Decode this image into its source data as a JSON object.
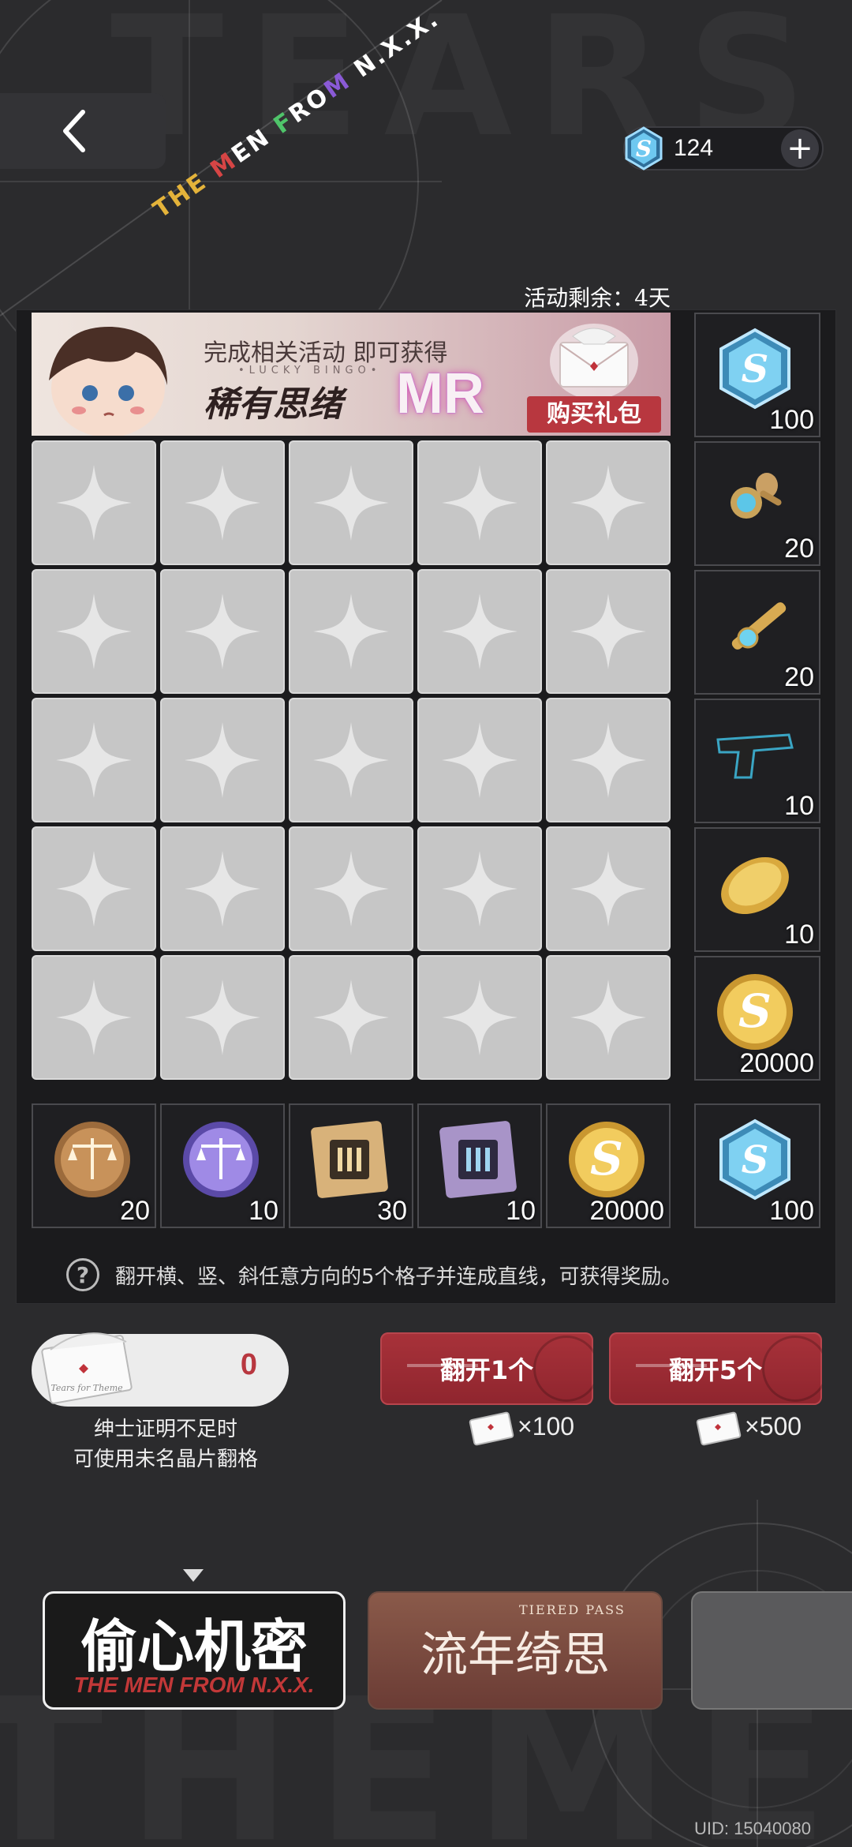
{
  "header": {
    "brand": [
      "THE ",
      "M",
      "EN ",
      "F",
      "RO",
      "M",
      " N.X.X."
    ],
    "currency_value": "124",
    "remaining_label": "活动剩余：4天"
  },
  "banner": {
    "line1": "完成相关活动 即可获得",
    "tagline": "•LUCKY BINGO•",
    "line2": "稀有思绪",
    "rarity": "MR",
    "buy_label": "购买礼包"
  },
  "board": {
    "rows": 5,
    "cols": 5
  },
  "row_rewards": [
    {
      "icon": "hexagon-s-crystal-icon",
      "qty": "100"
    },
    {
      "icon": "blue-gem-cufflink-icon",
      "qty": "20"
    },
    {
      "icon": "gold-tie-clip-icon",
      "qty": "20"
    },
    {
      "icon": "pistol-icon",
      "qty": "10"
    },
    {
      "icon": "gold-coin-tilted-icon",
      "qty": "10"
    },
    {
      "icon": "gold-s-coin-icon",
      "qty": "20000"
    }
  ],
  "col_rewards": [
    {
      "icon": "bronze-scales-badge-icon",
      "qty": "20"
    },
    {
      "icon": "purple-scales-badge-icon",
      "qty": "10"
    },
    {
      "icon": "gold-chip-card-icon",
      "qty": "30"
    },
    {
      "icon": "purple-chip-card-icon",
      "qty": "10"
    },
    {
      "icon": "gold-s-coin-icon",
      "qty": "20000"
    }
  ],
  "corner_reward": {
    "icon": "hexagon-s-crystal-icon",
    "qty": "100"
  },
  "rule": "翻开横、竖、斜任意方向的5个格子并连成直线，可获得奖励。",
  "ticket": {
    "count": "0",
    "note_line1": "绅士证明不足时",
    "note_line2": "可使用未名晶片翻格"
  },
  "actions": {
    "flip_one": "翻开1个",
    "flip_one_cost": "×100",
    "flip_five": "翻开5个",
    "flip_five_cost": "×500"
  },
  "tabs": {
    "tab1_title": "偷心机密",
    "tab1_sub": "THE MEN FROM N.X.X.",
    "tab2_sub": "TIERED PASS",
    "tab2_title": "流年绮思"
  },
  "uid": "UID: 15040080",
  "colors": {
    "accent_red": "#a8323a",
    "background": "#2b2b2d",
    "tile": "#c6c6c6"
  }
}
